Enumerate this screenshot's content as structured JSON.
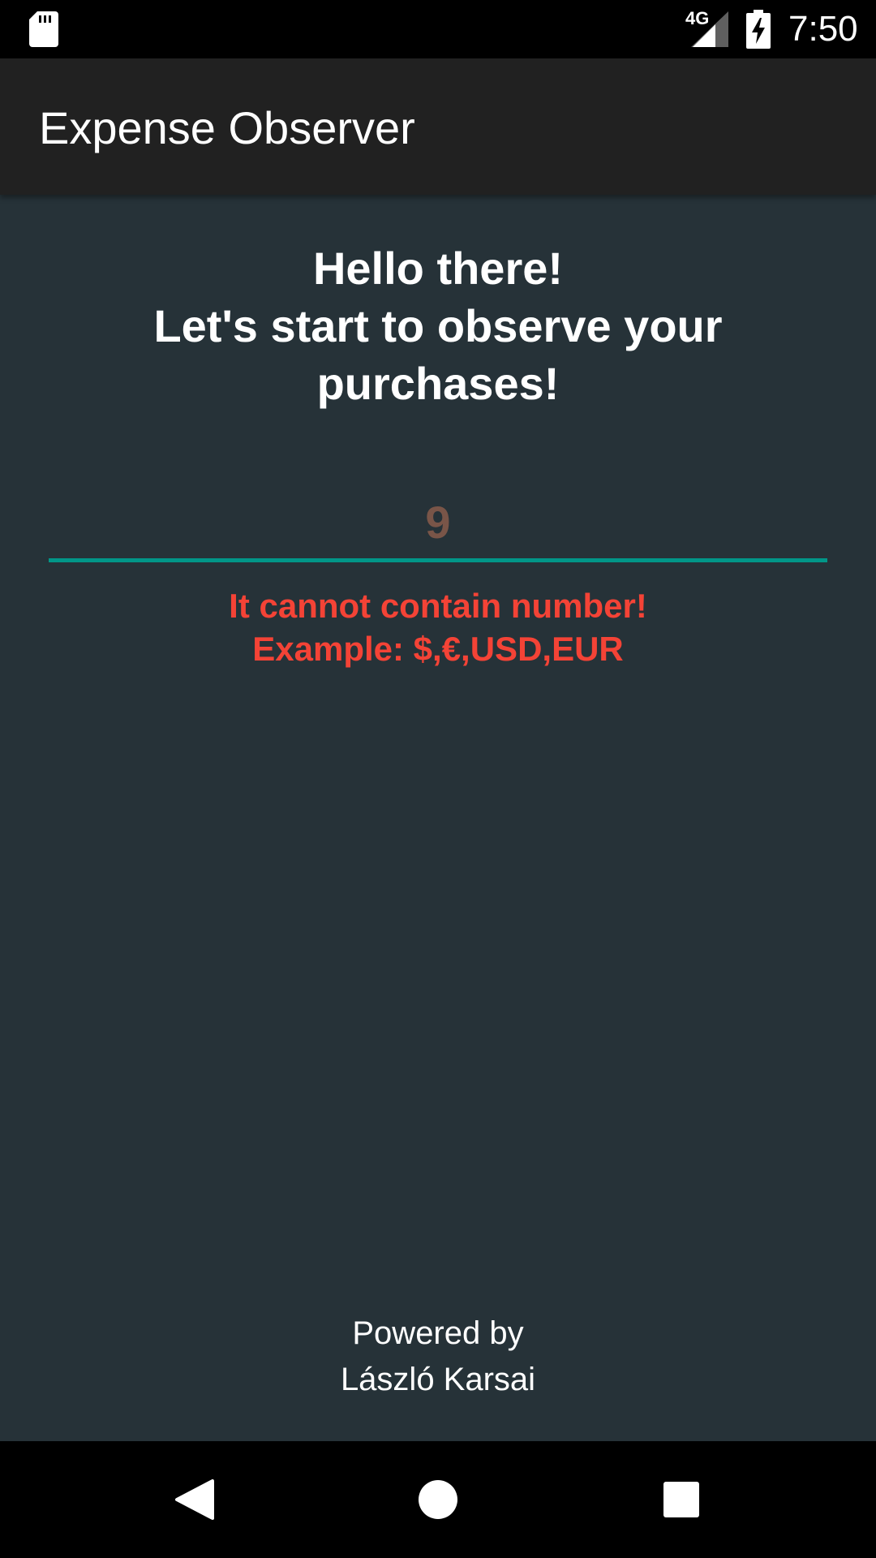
{
  "status_bar": {
    "time": "7:50",
    "network": "4G",
    "icons": [
      "sd-card-icon",
      "signal-icon",
      "battery-charging-icon"
    ]
  },
  "app_bar": {
    "title": "Expense Observer"
  },
  "main": {
    "greeting_lines": [
      "Hello there!",
      "Let's start to observe your",
      "purchases!"
    ],
    "currency_input": {
      "value": "9"
    },
    "error_lines": [
      "It cannot contain number!",
      "Example: $,€,USD,EUR"
    ]
  },
  "footer": {
    "lines": [
      "Powered by",
      "László Karsai"
    ]
  },
  "nav_bar": {
    "buttons": [
      "back-icon",
      "home-icon",
      "recents-icon"
    ]
  },
  "colors": {
    "background": "#263238",
    "app_bar": "#212121",
    "accent_underline": "#009688",
    "input_text": "#795548",
    "error": "#f44336"
  }
}
